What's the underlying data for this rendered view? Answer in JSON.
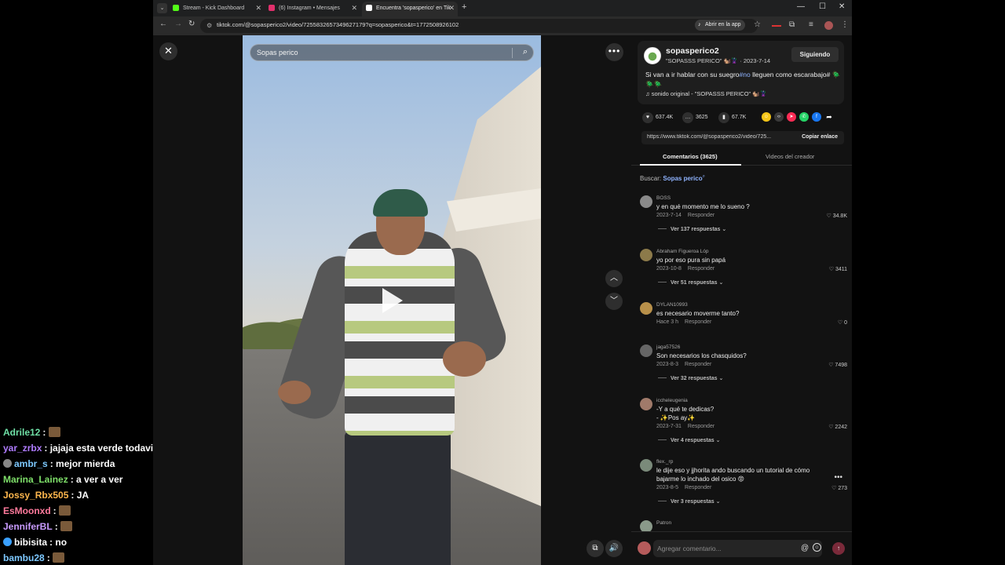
{
  "chat": {
    "faded_text": "",
    "messages": [
      {
        "user": "Adrile12",
        "color": "#6fe0a6",
        "text": "",
        "emote": true,
        "icon": ""
      },
      {
        "user": "yar_zrbx",
        "color": "#b07cff",
        "text": "jajaja esta verde todavia",
        "emote": false,
        "icon": ""
      },
      {
        "user": "ambr_s",
        "color": "#7dc8ff",
        "text": "mejor mierda",
        "emote": false,
        "icon": "#888888"
      },
      {
        "user": "Marina_Lainez",
        "color": "#7fe06a",
        "text": "a ver a ver",
        "emote": false,
        "icon": ""
      },
      {
        "user": "Jossy_Rbx505",
        "color": "#ffb74d",
        "text": "JA",
        "emote": false,
        "icon": ""
      },
      {
        "user": "EsMoonxd",
        "color": "#ff7a9c",
        "text": "",
        "emote": true,
        "icon": ""
      },
      {
        "user": "JenniferBL",
        "color": "#c99bff",
        "text": "",
        "emote": true,
        "icon": ""
      },
      {
        "user": "bibisita",
        "color": "#ffffff",
        "text": "no",
        "emote": false,
        "icon": "#3aa0ff"
      },
      {
        "user": "bambu28",
        "color": "#7dc8ff",
        "text": "",
        "emote": true,
        "icon": ""
      }
    ]
  },
  "browser": {
    "tabs": [
      {
        "title": "Stream - Kick Dashboard",
        "favicon_color": "#53fc18",
        "active": false
      },
      {
        "title": "(6) Instagram • Mensajes",
        "favicon_color": "#e1306c",
        "active": false
      },
      {
        "title": "Encuentra 'sopasperico' en Tik",
        "favicon_color": "#ffffff",
        "active": true
      }
    ],
    "url": "tiktok.com/@sopasperico2/video/7255832657349627179?q=sopasperico&t=1772508926102",
    "open_in_app": "Abrir en la app"
  },
  "video": {
    "search_query": "Sopas perico"
  },
  "post": {
    "creator": "sopasperico2",
    "creator_sub": "\"SOPASSS PERICO\" 🐿️🦹 · 2023-7-14",
    "follow_label": "Siguiendo",
    "caption_before": "Si van a ir hablar con su suegro",
    "caption_tag": "#no",
    "caption_after": " lleguen como escarabajo# 🪲🪲🪲",
    "sound": "♫  sonido original - \"SOPASSS PERICO\" 🐿️🦹",
    "likes": "637.4K",
    "comments": "3625",
    "saves": "67.7K",
    "link": "https://www.tiktok.com/@sopasperico2/video/725...",
    "copy_label": "Copiar enlace",
    "tab_comments": "Comentarios (3625)",
    "tab_creator": "Videos del creador",
    "search_prefix": "Buscar:",
    "search_term": "Sopas perico"
  },
  "comments": [
    {
      "user": "BOSS",
      "text": "y en qué momento me lo sueno ?",
      "date": "2023-7-14",
      "reply": "Responder",
      "likes": "34.8K",
      "replies": "Ver 137 respuestas ⌄",
      "avatar": "#8a8a8a"
    },
    {
      "user": "Abraham Figueroa Lóp",
      "text": "yo por eso pura sin papá",
      "date": "2023-10-8",
      "reply": "Responder",
      "likes": "3411",
      "replies": "Ver 51 respuestas ⌄",
      "avatar": "#8c7a4a"
    },
    {
      "user": "DYLAN10993",
      "text": "es necesario moverme tanto?",
      "date": "Hace 3 h",
      "reply": "Responder",
      "likes": "0",
      "replies": "",
      "avatar": "#b8904a"
    },
    {
      "user": "jaga57526",
      "text": "Son necesarios los chasquidos?",
      "date": "2023-8-3",
      "reply": "Responder",
      "likes": "7498",
      "replies": "Ver 32 respuestas ⌄",
      "avatar": "#666666"
    },
    {
      "user": "iccheleugenia",
      "text": "-Y a qué te dedicas?\n- ✨Pos ay✨",
      "date": "2023-7-31",
      "reply": "Responder",
      "likes": "2242",
      "replies": "Ver 4 respuestas ⌄",
      "avatar": "#a07a6a"
    },
    {
      "user": "flex._rp",
      "text": "le dije eso y jjhorita ando buscando un tutorial de cómo bajarme lo inchado del osico 😡",
      "date": "2023-8-5",
      "reply": "Responder",
      "likes": "273",
      "replies": "Ver 3 respuestas ⌄",
      "avatar": "#7a8a7a"
    },
    {
      "user": "Patron",
      "text": "",
      "date": "",
      "reply": "",
      "likes": "",
      "replies": "",
      "avatar": "#8a9a8a"
    }
  ],
  "composer": {
    "placeholder": "Agregar comentario..."
  }
}
